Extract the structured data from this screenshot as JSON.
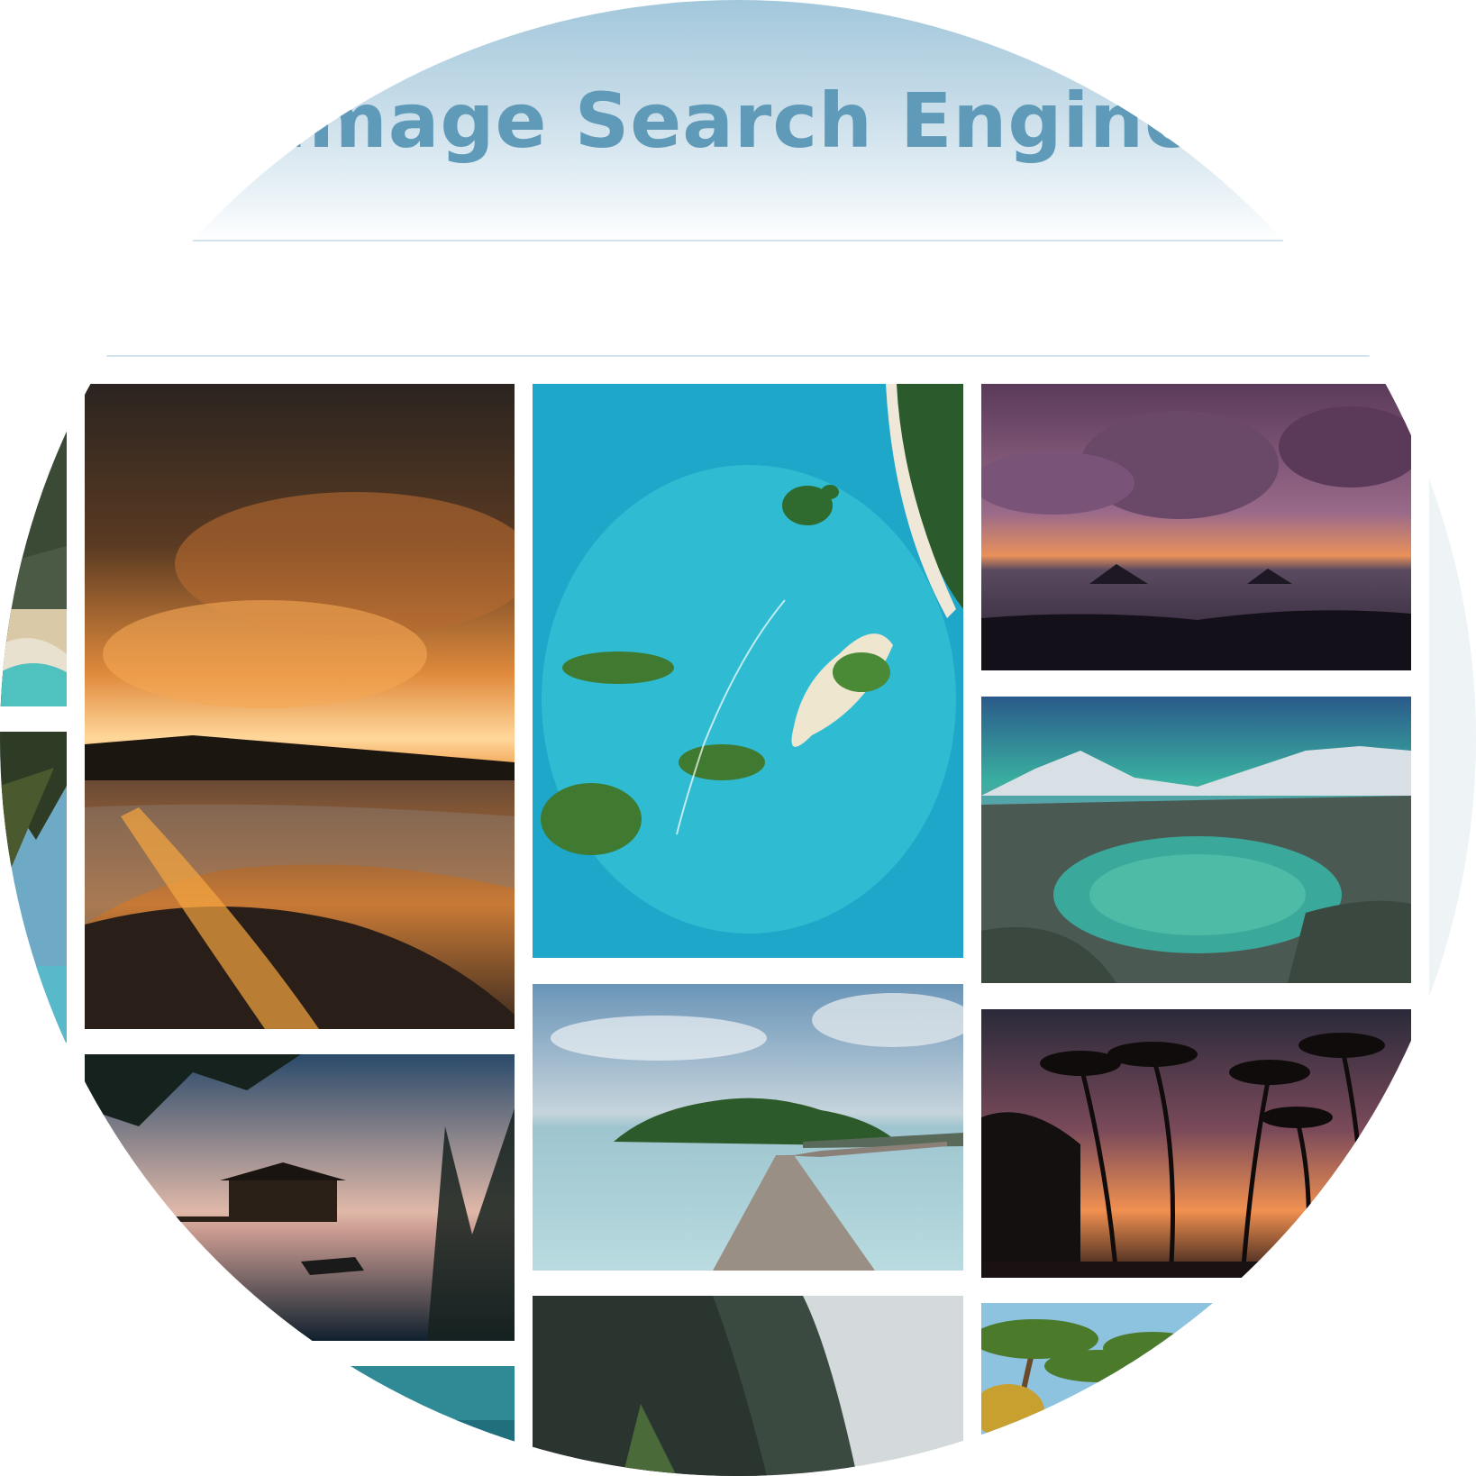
{
  "header": {
    "title": "Image Search Engine"
  },
  "search": {
    "value": "",
    "placeholder": ""
  },
  "colors": {
    "title": "#5f9ab8",
    "header_gradient_top": "#a2c7db",
    "divider": "#d3e3ec",
    "background": "#ffffff"
  },
  "results": [
    {
      "subject": "waterfall-pools"
    },
    {
      "subject": "palm-lagoon"
    },
    {
      "subject": "orange-sunset-beach"
    },
    {
      "subject": "stilt-house-dusk"
    },
    {
      "subject": "teal-sea"
    },
    {
      "subject": "aerial-turquoise-islands"
    },
    {
      "subject": "wooden-pier-island"
    },
    {
      "subject": "limestone-cliff"
    },
    {
      "subject": "purple-cloud-sunset-islets"
    },
    {
      "subject": "aurora-rock-pool"
    },
    {
      "subject": "palm-silhouettes-sunset"
    },
    {
      "subject": "palm-trees-daylight"
    }
  ]
}
